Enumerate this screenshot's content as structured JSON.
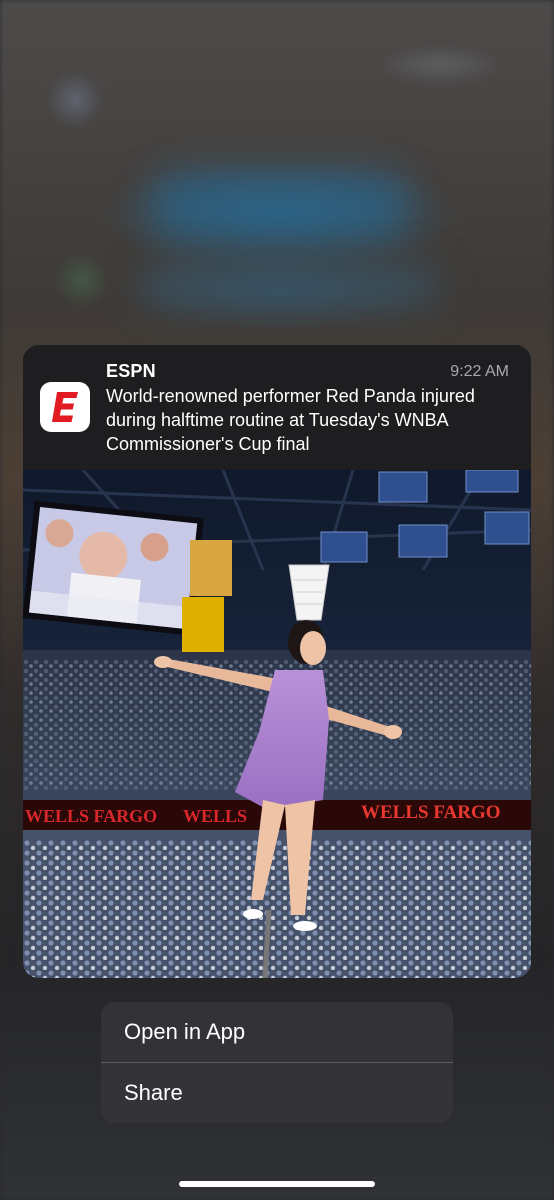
{
  "notification": {
    "app_name": "ESPN",
    "time": "9:22 AM",
    "message": "World-renowned performer Red Panda injured during halftime routine at Tuesday's WNBA Commissioner's Cup final",
    "app_icon": "espn-app-icon",
    "brand_color": "#e21a22",
    "photo": {
      "banner_text_left_1": "WELLS FARGO",
      "banner_text_left_2": "WELLS",
      "banner_text_right": "WELLS FARGO",
      "banner_color": "#d7262c"
    }
  },
  "menu": {
    "items": [
      {
        "label": "Open in App"
      },
      {
        "label": "Share"
      }
    ]
  }
}
